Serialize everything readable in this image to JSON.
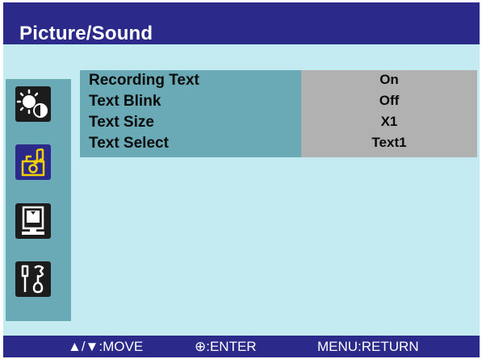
{
  "window": {
    "title": "Picture/Sound"
  },
  "sidebar": {
    "items": [
      {
        "name": "picture",
        "icon": "brightness-contrast-icon",
        "active": false
      },
      {
        "name": "picture-sound",
        "icon": "camera-music-icon",
        "active": true
      },
      {
        "name": "display",
        "icon": "monitor-icon",
        "active": false
      },
      {
        "name": "setup",
        "icon": "tools-icon",
        "active": false
      }
    ]
  },
  "menu": {
    "rows": [
      {
        "label": "Recording Text",
        "value": "On"
      },
      {
        "label": "Text Blink",
        "value": "Off"
      },
      {
        "label": "Text Size",
        "value": "X1"
      },
      {
        "label": "Text Select",
        "value": "Text1"
      }
    ]
  },
  "footer": {
    "move": "▲/▼:MOVE",
    "enter": "⊕:ENTER",
    "return": "MENU:RETURN"
  },
  "colors": {
    "title_bar": "#2b2a8a",
    "panel_bg": "#c4eaf2",
    "label_bg": "#6aaab7",
    "value_bg": "#b1b1b1",
    "active_icon_bg": "#2b2a8a",
    "active_icon_fg": "#f5d000"
  }
}
